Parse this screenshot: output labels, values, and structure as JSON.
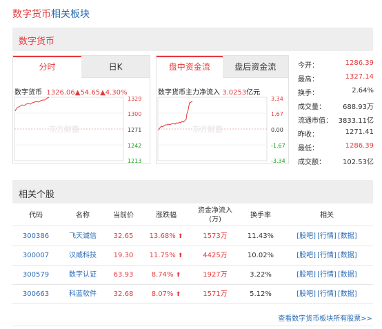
{
  "page_title": {
    "part1": "数字货币",
    "part2": "相关板块"
  },
  "section1": {
    "title": "数字货币"
  },
  "panel_a": {
    "tabs": [
      {
        "label": "分时",
        "active": true
      },
      {
        "label": "日K",
        "active": false
      }
    ],
    "head": {
      "name": "数字货币",
      "price": "1326.06",
      "change": "54.65",
      "pct": "4.30%"
    },
    "axis": [
      "1329",
      "1300",
      "1271",
      "1242",
      "1213"
    ],
    "watermark": "东方财富"
  },
  "panel_b": {
    "tabs": [
      {
        "label": "盘中资金流",
        "active": true
      },
      {
        "label": "盘后资金流",
        "active": false
      }
    ],
    "head": {
      "label": "数字货币主力净流入",
      "value": "3.0253",
      "unit": "亿元"
    },
    "axis": [
      "3.34",
      "1.67",
      "0.00",
      "-1.67",
      "-3.34"
    ],
    "watermark": "东方财富"
  },
  "stats": [
    {
      "key": "今开：",
      "value": "1286.39",
      "color": "#e4393c"
    },
    {
      "key": "最高：",
      "value": "1327.14",
      "color": "#e4393c"
    },
    {
      "key": "换手：",
      "value": "2.64%",
      "color": "#333333"
    },
    {
      "key": "成交量：",
      "value": "688.93万",
      "color": "#333333"
    },
    {
      "key": "流通市值：",
      "value": "3833.11亿",
      "color": "#333333"
    },
    {
      "key": "昨收：",
      "value": "1271.41",
      "color": "#333333"
    },
    {
      "key": "最低：",
      "value": "1286.39",
      "color": "#e4393c"
    },
    {
      "key": "成交额：",
      "value": "102.53亿",
      "color": "#333333"
    }
  ],
  "section2": {
    "title": "相关个股"
  },
  "table": {
    "headers": {
      "code": "代码",
      "name": "名称",
      "price": "当前价",
      "chg": "涨跌幅",
      "flow_line1": "资金净流入",
      "flow_line2": "(万)",
      "turn": "换手率",
      "rel": "相关"
    },
    "rows": [
      {
        "code": "300386",
        "name": "飞天诚信",
        "price": "32.65",
        "chg": "13.68%",
        "flow": "1573万",
        "turn": "11.43%"
      },
      {
        "code": "300007",
        "name": "汉威科技",
        "price": "19.30",
        "chg": "11.75%",
        "flow": "4425万",
        "turn": "10.02%"
      },
      {
        "code": "300579",
        "name": "数字认证",
        "price": "63.93",
        "chg": "8.74%",
        "flow": "1927万",
        "turn": "3.22%"
      },
      {
        "code": "300663",
        "name": "科蓝软件",
        "price": "32.68",
        "chg": "8.07%",
        "flow": "1571万",
        "turn": "5.12%"
      }
    ],
    "links": [
      "[股吧]",
      "[行情]",
      "[数据]"
    ]
  },
  "more_link": "查看数字货币板块所有股票>>",
  "colors": {
    "accent": "#e4393c",
    "link": "#2b6bb5",
    "up": "#e4393c",
    "down": "#1a9a1a"
  }
}
